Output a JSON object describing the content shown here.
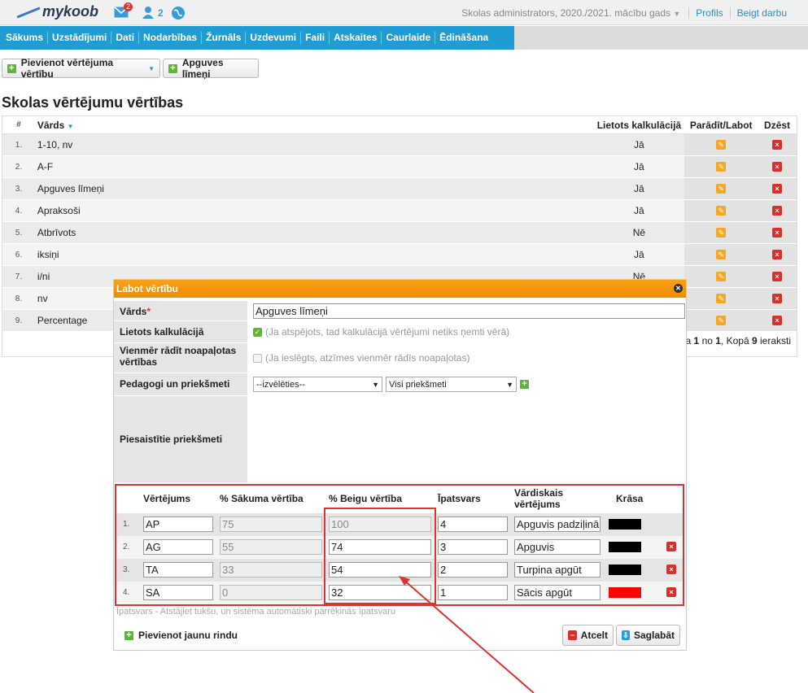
{
  "topbar": {
    "logo": "mykoob",
    "mail_count": "2",
    "users_count": "2",
    "context": "Skolas administrators, 2020./2021. mācību gads",
    "profile": "Profils",
    "logout": "Beigt darbu"
  },
  "menu": [
    "Sākums",
    "Uzstādījumi",
    "Dati",
    "Nodarbības",
    "Žurnāls",
    "Uzdevumi",
    "Faili",
    "Atskaites",
    "Caurlaide",
    "Ēdināšana"
  ],
  "toolbar": {
    "add_button": "Pievienot vērtējuma vērtību",
    "levels_button": "Apguves līmeņi"
  },
  "page_title": "Skolas vērtējumu vērtības",
  "table": {
    "headers": {
      "num": "#",
      "name": "Vārds",
      "calc": "Lietots kalkulācijā",
      "edit": "Parādīt/Labot",
      "del": "Dzēst"
    },
    "rows": [
      {
        "num": "1.",
        "name": "1-10, nv",
        "calc": "Jā"
      },
      {
        "num": "2.",
        "name": "A-F",
        "calc": "Jā"
      },
      {
        "num": "3.",
        "name": "Apguves līmeņi",
        "calc": "Jā"
      },
      {
        "num": "4.",
        "name": "Apraksoši",
        "calc": "Jā"
      },
      {
        "num": "5.",
        "name": "Atbrīvots",
        "calc": "Nē"
      },
      {
        "num": "6.",
        "name": "iksiņi",
        "calc": "Jā"
      },
      {
        "num": "7.",
        "name": "i/ni",
        "calc": "Nē"
      },
      {
        "num": "8.",
        "name": "nv",
        "calc": ""
      },
      {
        "num": "9.",
        "name": "Percentage",
        "calc": ""
      }
    ],
    "pager_prefix": "a ",
    "pager_from": "1",
    "pager_mid": " no ",
    "pager_to": "1",
    "pager_total_label": ", Kopā ",
    "pager_total": "9",
    "pager_suffix": " ieraksti"
  },
  "modal": {
    "title": "Labot vērtību",
    "name_label": "Vārds",
    "name_value": "Apguves līmeņi",
    "calc_label": "Lietots kalkulācijā",
    "calc_hint": "(Ja atspējots, tad kalkulācijā vērtējumi netiks ņemti vērā)",
    "round_label": "Vienmēr rādīt noapaļotas vērtības",
    "round_hint": "(Ja ieslēgts, atzīmes vienmēr rādīs noapaļotas)",
    "teachers_label": "Pedagogi un priekšmeti",
    "teacher_select": "--izvēlēties--",
    "subject_select": "Visi priekšmeti",
    "linked_label": "Piesaistītie priekšmeti",
    "grades_headers": {
      "grade": "Vērtējums",
      "start": "% Sākuma vērtība",
      "end": "% Beigu vērtība",
      "weight": "Īpatsvars",
      "verbal": "Vārdiskais vērtējums",
      "color": "Krāsa"
    },
    "grades": [
      {
        "num": "1.",
        "grade": "AP",
        "start": "75",
        "end": "100",
        "weight": "4",
        "verbal": "Apguvis padziļinā",
        "color": "#000000"
      },
      {
        "num": "2.",
        "grade": "AG",
        "start": "55",
        "end": "74",
        "weight": "3",
        "verbal": "Apguvis",
        "color": "#000000"
      },
      {
        "num": "3.",
        "grade": "TA",
        "start": "33",
        "end": "54",
        "weight": "2",
        "verbal": "Turpina apgūt",
        "color": "#000000"
      },
      {
        "num": "4.",
        "grade": "SA",
        "start": "0",
        "end": "32",
        "weight": "1",
        "verbal": "Sācis apgūt",
        "color": "#ff0000"
      }
    ],
    "weight_hint": "Īpatsvars - Atstājiet tukšu, un sistēma automātiski pārrēķinās īpatsvaru",
    "add_row": "Pievienot jaunu rindu",
    "cancel": "Atcelt",
    "save": "Saglabāt"
  },
  "colors": {
    "accent": "#1f9cd4",
    "modal_header": "#f59a0f",
    "annotation": "#dd3333"
  }
}
